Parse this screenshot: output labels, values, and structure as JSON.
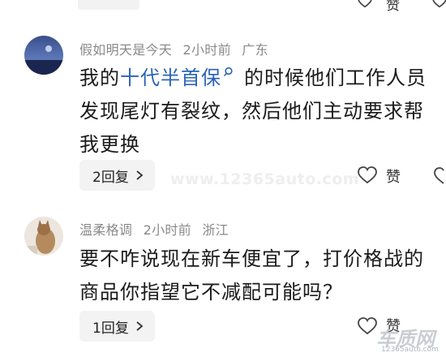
{
  "top_remnant": {
    "like_label": "赞"
  },
  "comments": [
    {
      "author": "假如明天是今天",
      "time": "2小时前",
      "location": "广东",
      "text_before": "我的",
      "link_text": "十代半首保",
      "text_after": "的时候他们工作人员发现尾灯有裂纹，然后他们主动要求帮我更换",
      "reply_label": "2回复",
      "like_label": "赞",
      "avatar_icon": "moon-landscape-avatar"
    },
    {
      "author": "温柔格调",
      "time": "2小时前",
      "location": "浙江",
      "text": "要不咋说现在新车便宜了，打价格战的商品你指望它不减配可能吗？",
      "reply_label": "1回复",
      "like_label": "赞",
      "avatar_icon": "cat-avatar"
    }
  ],
  "watermark": "www.12365auto.com",
  "logo": {
    "text": "车质网",
    "url": "12365auto.com"
  },
  "colors": {
    "link": "#2a63b8",
    "meta": "#8a8a8a",
    "pill": "#f3f3f3"
  }
}
